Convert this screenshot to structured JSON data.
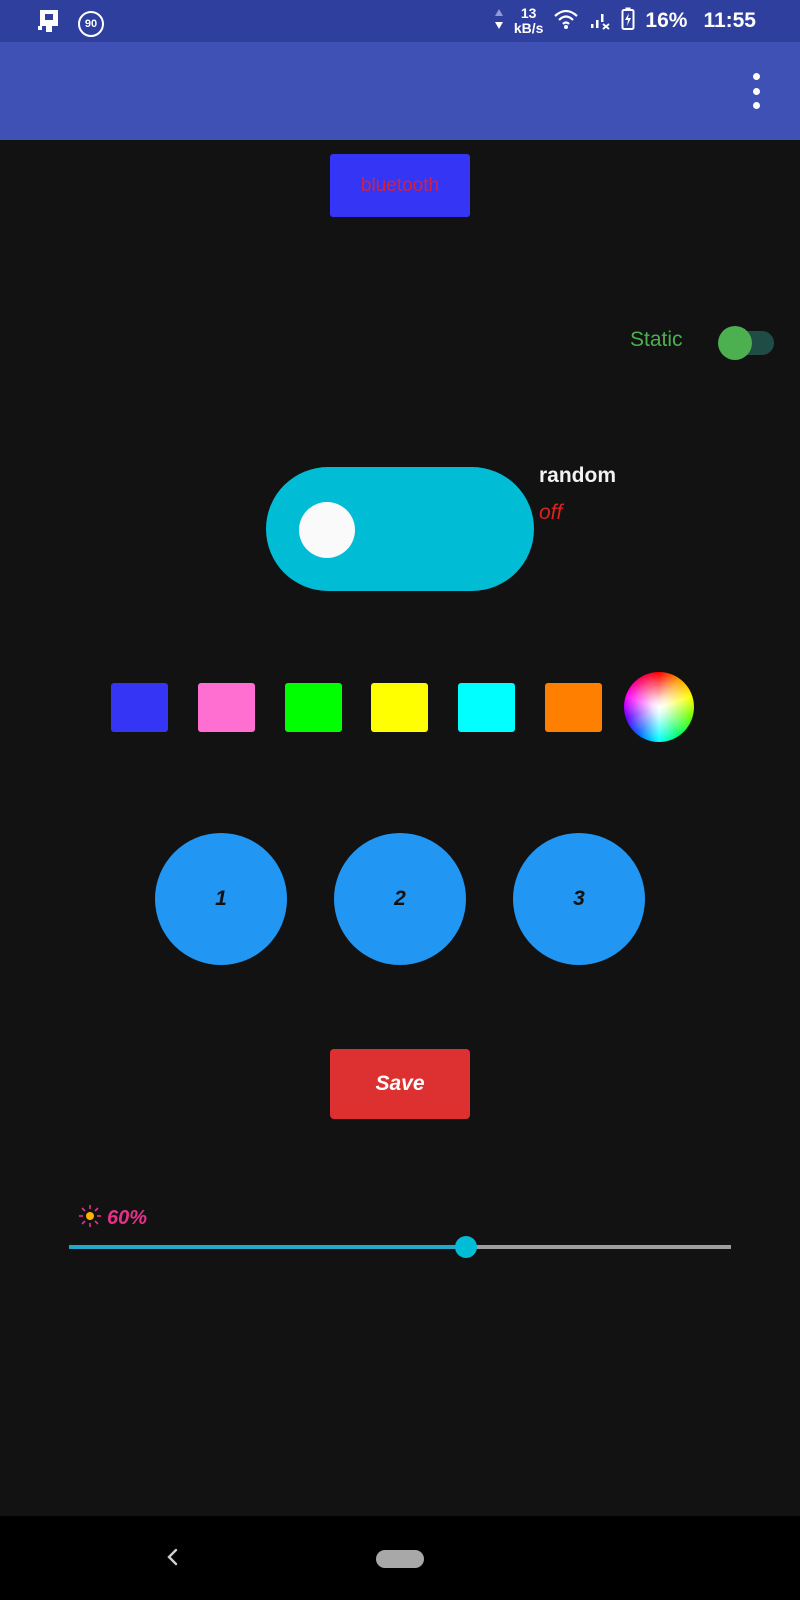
{
  "status_bar": {
    "badge": "90",
    "speed_value": "13",
    "speed_unit": "kB/s",
    "battery": "16%",
    "time": "11:55"
  },
  "app_bar": {
    "menu_icon": "overflow-menu-icon"
  },
  "bluetooth_button": {
    "label": "bluetooth",
    "bg_color": "#3535f5",
    "text_color": "#d4213d"
  },
  "static_switch": {
    "label": "Static",
    "on": true,
    "color": "#4caf50"
  },
  "random_toggle": {
    "label": "random",
    "state": "off",
    "color": "#00bcd4"
  },
  "swatches": [
    {
      "name": "blue",
      "color": "#3535f5"
    },
    {
      "name": "pink",
      "color": "#ff6ed0"
    },
    {
      "name": "green",
      "color": "#00ff00"
    },
    {
      "name": "yellow",
      "color": "#ffff00"
    },
    {
      "name": "cyan",
      "color": "#00ffff"
    },
    {
      "name": "orange",
      "color": "#ff8000"
    }
  ],
  "color_wheel": {
    "icon": "color-wheel-icon"
  },
  "presets": [
    "1",
    "2",
    "3"
  ],
  "save_button": {
    "label": "Save",
    "color": "#dd3030"
  },
  "brightness": {
    "icon": "brightness-sun-icon",
    "value_label": "60%",
    "value": 0.6
  }
}
